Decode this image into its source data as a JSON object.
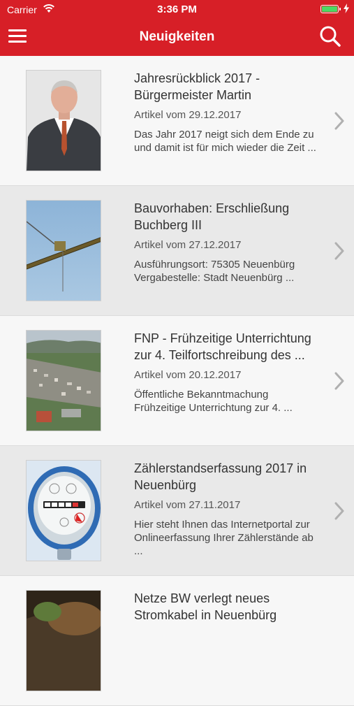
{
  "status_bar": {
    "carrier": "Carrier",
    "time": "3:36 PM"
  },
  "nav": {
    "title": "Neuigkeiten"
  },
  "articles": [
    {
      "title": "Jahresrückblick 2017 - Bürgermeister Martin",
      "date": "Artikel vom 29.12.2017",
      "excerpt": "Das Jahr 2017 neigt sich dem Ende zu und damit ist für mich wieder die Zeit ..."
    },
    {
      "title": "Bauvorhaben: Erschließung Buchberg III",
      "date": "Artikel vom 27.12.2017",
      "excerpt": "Ausführungsort: 75305 Neuenbürg Vergabestelle:  Stadt Neuenbürg ..."
    },
    {
      "title": "FNP - Frühzeitige Unterrichtung zur 4. Teilfortschreibung des ...",
      "date": "Artikel vom 20.12.2017",
      "excerpt": "Öffentliche Bekanntmachung Frühzeitige Unterrichtung zur 4. ..."
    },
    {
      "title": "Zählerstandserfassung 2017 in Neuenbürg",
      "date": "Artikel vom 27.11.2017",
      "excerpt": "Hier steht Ihnen das Internetportal zur Onlineerfassung Ihrer Zählerstände ab ..."
    },
    {
      "title": "Netze BW verlegt neues Stromkabel in Neuenbürg",
      "date": "",
      "excerpt": ""
    }
  ]
}
